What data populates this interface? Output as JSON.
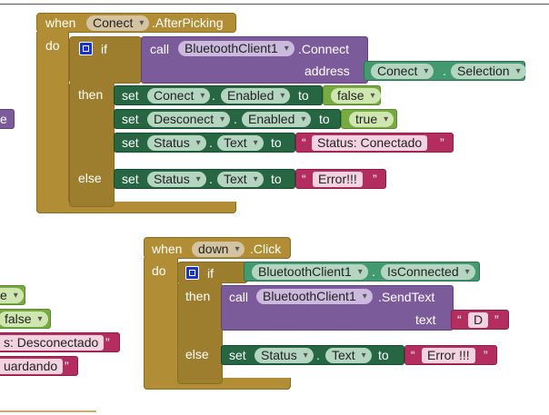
{
  "block1": {
    "when": "when",
    "component": "Conect",
    "event": ".AfterPicking",
    "do": "do",
    "if": "if",
    "call": "call",
    "call_component": "BluetoothClient1",
    "call_method": ".Connect",
    "address_label": "address",
    "address_component": "Conect",
    "address_dot": ".",
    "address_prop": "Selection",
    "then": "then",
    "set1": {
      "set": "set",
      "component": "Conect",
      "dot": ".",
      "prop": "Enabled",
      "to": "to",
      "value": "false"
    },
    "set2": {
      "set": "set",
      "component": "Desconect",
      "dot": ".",
      "prop": "Enabled",
      "to": "to",
      "value": "true"
    },
    "set3": {
      "set": "set",
      "component": "Status",
      "dot": ".",
      "prop": "Text",
      "to": "to",
      "value": "Status: Conectado",
      "ql": "“",
      "qr": "”"
    },
    "else": "else",
    "set4": {
      "set": "set",
      "component": "Status",
      "dot": ".",
      "prop": "Text",
      "to": "to",
      "value": "Error!!!",
      "ql": "“",
      "qr": "”"
    }
  },
  "block2": {
    "when": "when",
    "component": "down",
    "event": ".Click",
    "do": "do",
    "if": "if",
    "if_component": "BluetoothClient1",
    "if_dot": ".",
    "if_prop": "IsConnected",
    "then": "then",
    "call": "call",
    "call_component": "BluetoothClient1",
    "call_method": ".SendText",
    "text_label": "text",
    "text_value": "D",
    "ql": "“",
    "qr": "”",
    "else": "else",
    "set": {
      "set": "set",
      "component": "Status",
      "dot": ".",
      "prop": "Text",
      "to": "to",
      "value": "Error !!!",
      "ql": "“",
      "qr": "”"
    }
  },
  "partial": {
    "left_e1": "e",
    "left_e2": "e",
    "left_false": "false",
    "left_desconectado": "s: Desconectado",
    "left_desconectado_q": "”",
    "left_guardando": "uardando",
    "left_guardando_q": "”"
  }
}
